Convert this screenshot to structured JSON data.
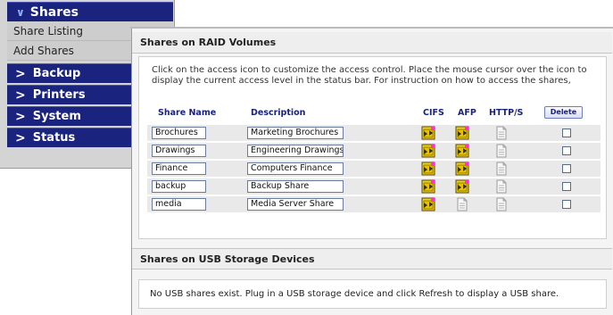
{
  "nav": {
    "current_section": "Shares",
    "sub_items": [
      "Share Listing",
      "Add Shares"
    ],
    "sections": [
      "Backup",
      "Printers",
      "System",
      "Status"
    ]
  },
  "raid": {
    "title": "Shares on RAID Volumes",
    "intro": "Click on the access icon to customize the access control. Place the mouse cursor over the icon to display the current access level in the status bar. For instruction on how to access the shares,",
    "columns": {
      "share_name": "Share Name",
      "description": "Description",
      "cifs": "CIFS",
      "afp": "AFP",
      "http": "HTTP/S"
    },
    "delete_label": "Delete",
    "rows": [
      {
        "name": "Brochures",
        "description": "Marketing Brochures",
        "afp": "enabled"
      },
      {
        "name": "Drawings",
        "description": "Engineering Drawings",
        "afp": "enabled"
      },
      {
        "name": "Finance",
        "description": "Computers Finance",
        "afp": "enabled"
      },
      {
        "name": "backup",
        "description": "Backup Share",
        "afp": "enabled"
      },
      {
        "name": "media",
        "description": "Media Server Share",
        "afp": "disabled"
      }
    ]
  },
  "usb": {
    "title": "Shares on USB Storage Devices",
    "message": "No USB shares exist. Plug in a USB storage device and click Refresh to display a USB share."
  },
  "colors": {
    "nav_blue": "#1a237e",
    "header_text": "#1a237e",
    "icon_yellow": "#f2d31b"
  },
  "icons": {
    "enabled": "folder-access-enabled-icon",
    "disabled": "folder-access-disabled-icon"
  }
}
